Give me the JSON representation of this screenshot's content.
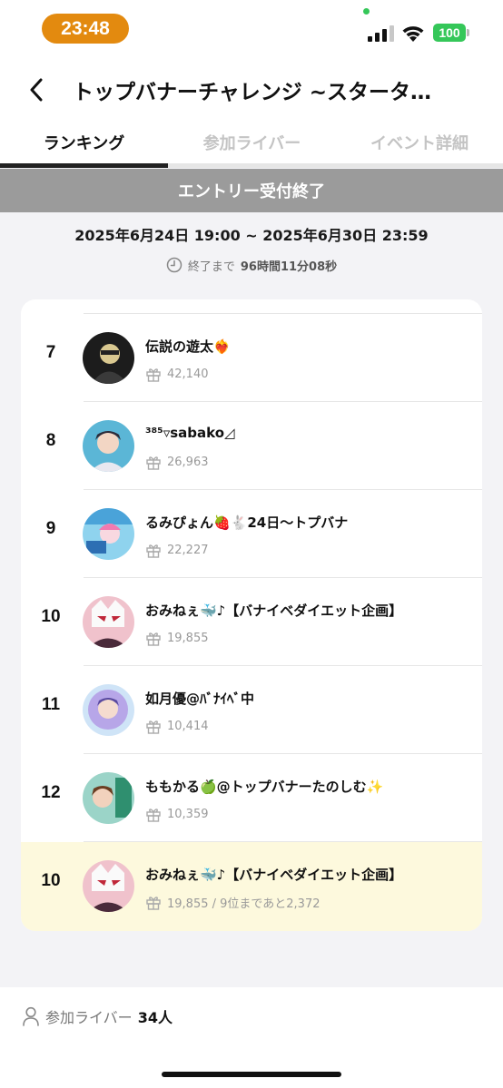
{
  "status_bar": {
    "time": "23:48",
    "battery": "100"
  },
  "header": {
    "title": "トップバナーチャレンジ ~スタータ…"
  },
  "tabs": [
    {
      "label": "ランキング",
      "active": true
    },
    {
      "label": "参加ライバー",
      "active": false
    },
    {
      "label": "イベント詳細",
      "active": false
    }
  ],
  "banner": {
    "text": "エントリー受付終了"
  },
  "event": {
    "date_range": "2025年6月24日 19:00 ~ 2025年6月30日 23:59",
    "countdown_label": "終了まで",
    "countdown_value": "96時間11分08秒"
  },
  "ranking": [
    {
      "rank": "7",
      "name": "伝説の遊太❤️‍🔥",
      "score": "42,140"
    },
    {
      "rank": "8",
      "name": "³⁸⁵▿sabako◿",
      "score": "26,963"
    },
    {
      "rank": "9",
      "name": "るみぴょん🍓🐇24日〜トプバナ",
      "score": "22,227"
    },
    {
      "rank": "10",
      "name": "おみねぇ🐳♪【バナイベダイエット企画】",
      "score": "19,855"
    },
    {
      "rank": "11",
      "name": "如月優@ﾊﾞﾅｲﾍﾞ中",
      "score": "10,414"
    },
    {
      "rank": "12",
      "name": "ももかる🍏@トップバナーたのしむ✨",
      "score": "10,359"
    }
  ],
  "my_rank": {
    "rank": "10",
    "name": "おみねぇ🐳♪【バナイベダイエット企画】",
    "score": "19,855 / 9位まであと2,372"
  },
  "footer": {
    "participants_label": "参加ライバー",
    "participants_count": "34人"
  },
  "colors": {
    "accent_time": "#e38a0f",
    "battery": "#35c759",
    "banner_bg": "#9b9b9b",
    "my_row_bg": "#fdf9dd"
  }
}
